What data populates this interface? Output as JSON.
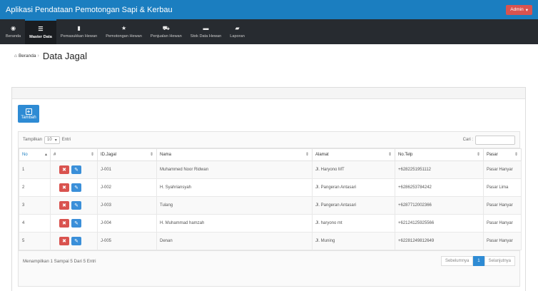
{
  "app": {
    "title": "Aplikasi Pendataan Pemotongan Sapi & Kerbau",
    "user_menu": "Admin"
  },
  "nav": [
    {
      "label": "Beranda",
      "icon": "dashboard-icon",
      "glyph": "◉"
    },
    {
      "label": "Master Data",
      "icon": "list-icon",
      "glyph": "☰",
      "active": true
    },
    {
      "label": "Pemasukkan Hewan",
      "icon": "file-icon",
      "glyph": "▮"
    },
    {
      "label": "Pemotongan Hewan",
      "icon": "star-icon",
      "glyph": "★"
    },
    {
      "label": "Penjualan Hewan",
      "icon": "cart-icon",
      "glyph": "⛟"
    },
    {
      "label": "Stok Data Hewan",
      "icon": "folder-icon",
      "glyph": "▬"
    },
    {
      "label": "Laporan",
      "icon": "folder-open-icon",
      "glyph": "▰"
    }
  ],
  "breadcrumb": {
    "home": "Beranda",
    "current": "Data Jagal"
  },
  "add_button": "Tambah",
  "table_tools": {
    "show_prefix": "Tampilkan",
    "page_length": "10",
    "show_suffix": "Entri",
    "search_label": "Cari :",
    "search_value": ""
  },
  "table": {
    "headers": [
      "No",
      "#",
      "ID.Jagal",
      "Nama",
      "Alamat",
      "No.Telp",
      "Pasar"
    ],
    "rows": [
      [
        "1",
        "",
        "J-001",
        "Muhammed Noor Ridwan",
        "Jl. Haryono MT",
        "+6282251951112",
        "Pasar Hanyar"
      ],
      [
        "2",
        "",
        "J-002",
        "H. Syahriansyah",
        "Jl. Pangeran Antasari",
        "+6286253784242",
        "Pasar Lima"
      ],
      [
        "3",
        "",
        "J-003",
        "Tulang",
        "Jl. Pangeran Antasari",
        "+6287712002366",
        "Pasar Hanyar"
      ],
      [
        "4",
        "",
        "J-004",
        "H. Muhammad hamzah",
        "Jl. haryono mt",
        "+62124125925566",
        "Pasar Hanyar"
      ],
      [
        "5",
        "",
        "J-005",
        "Denan",
        "Jl. Muning",
        "+62281249812649",
        "Pasar Hanyar"
      ]
    ]
  },
  "footer": {
    "info": "Menampilkan 1 Sampai 5 Dari 5 Entri",
    "prev": "Sebelumnya",
    "page": "1",
    "next": "Selanjutnya"
  },
  "colors": {
    "topbar": "#1b7ec0",
    "navbar": "#272b30",
    "primary": "#2e8bd4",
    "danger": "#d9534f"
  }
}
